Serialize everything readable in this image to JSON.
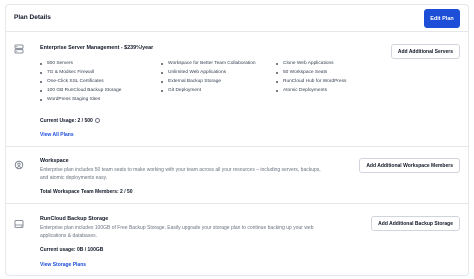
{
  "header": {
    "title": "Plan Details",
    "edit_button": "Edit Plan"
  },
  "server_plan": {
    "title": "Enterprise Server Management - $239⅔/year",
    "add_button": "Add Additional Servers",
    "features": [
      [
        "500 Servers",
        "7G & Modsec Firewall",
        "One-Click SSL Certificates",
        "100 GB RunCloud Backup Storage",
        "WordPress Staging Sites"
      ],
      [
        "Workspace for Better Team Collaboration",
        "Unlimited Web Applications",
        "External Backup Storage",
        "Git Deployment"
      ],
      [
        "Clone Web Applications",
        "50 Workspace Seats",
        "RunCloud Hub for WordPress",
        "Atomic Deployments"
      ]
    ],
    "usage": "Current Usage: 2 / 500",
    "link": "View All Plans"
  },
  "workspace": {
    "title": "Workspace",
    "description": "Enterprise plan includes 50 team seats to make working with your team across all your resources – including servers, backups, and atomic deployments easy.",
    "add_button": "Add Additional Workspace Members",
    "total": "Total Workspace Team Members: 2 / 50"
  },
  "backup": {
    "title": "RunCloud Backup Storage",
    "description": "Enterprise plan includes 100GB of Free Backup Storage. Easily upgrade your storage plan to continue backing up your web applications & databases.",
    "add_button": "Add Additional Backup Storage",
    "usage": "Current usage: 0B / 100GB",
    "link": "View Storage Plans"
  }
}
